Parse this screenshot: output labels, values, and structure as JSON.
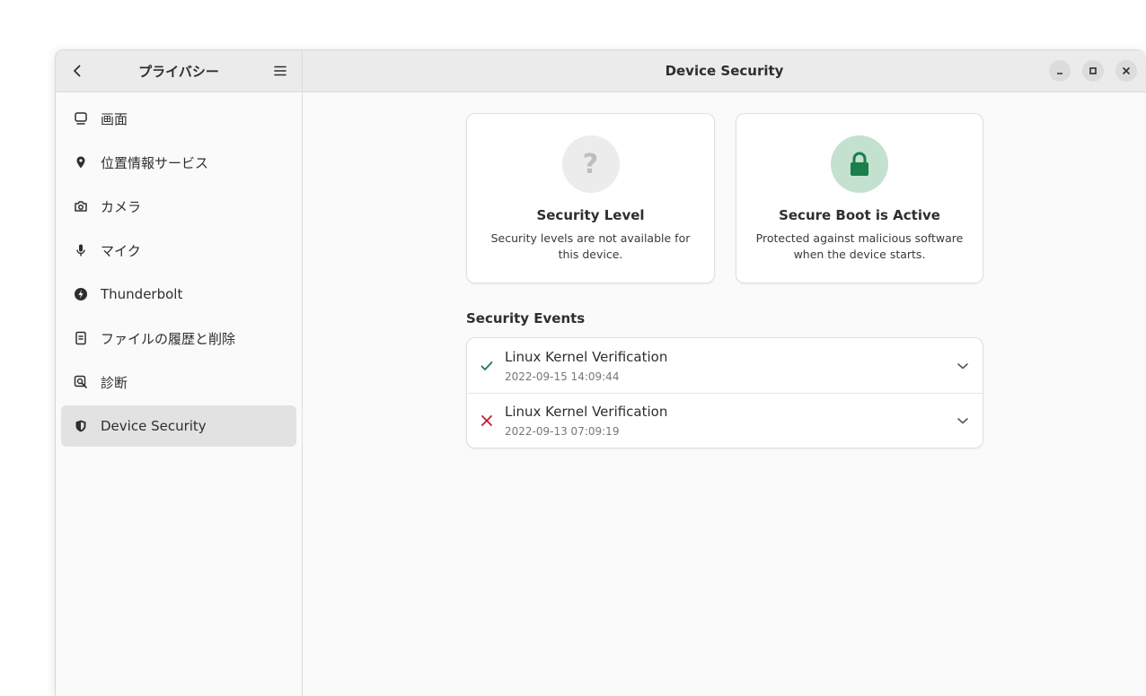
{
  "sidebar": {
    "title": "プライバシー",
    "items": [
      {
        "label": "画面",
        "icon": "display-icon"
      },
      {
        "label": "位置情報サービス",
        "icon": "location-icon"
      },
      {
        "label": "カメラ",
        "icon": "camera-icon"
      },
      {
        "label": "マイク",
        "icon": "microphone-icon"
      },
      {
        "label": "Thunderbolt",
        "icon": "thunderbolt-icon"
      },
      {
        "label": "ファイルの履歴と削除",
        "icon": "file-history-icon"
      },
      {
        "label": "診断",
        "icon": "diagnostics-icon"
      },
      {
        "label": "Device Security",
        "icon": "shield-icon",
        "selected": true
      }
    ]
  },
  "header": {
    "title": "Device Security"
  },
  "cards": {
    "security_level": {
      "title": "Security Level",
      "description": "Security levels are not available for this device.",
      "icon": "question-icon"
    },
    "secure_boot": {
      "title": "Secure Boot is Active",
      "description": "Protected against malicious software when the device starts.",
      "icon": "lock-icon"
    }
  },
  "events": {
    "title": "Security Events",
    "items": [
      {
        "title": "Linux Kernel Verification",
        "time": "2022-09-15 14:09:44",
        "status": "success"
      },
      {
        "title": "Linux Kernel Verification",
        "time": "2022-09-13 07:09:19",
        "status": "failure"
      }
    ]
  },
  "colors": {
    "success": "#1a7f4b",
    "failure": "#c01c28",
    "lock_badge": "#c4e1d0",
    "lock_icon": "#1a7f4b"
  }
}
